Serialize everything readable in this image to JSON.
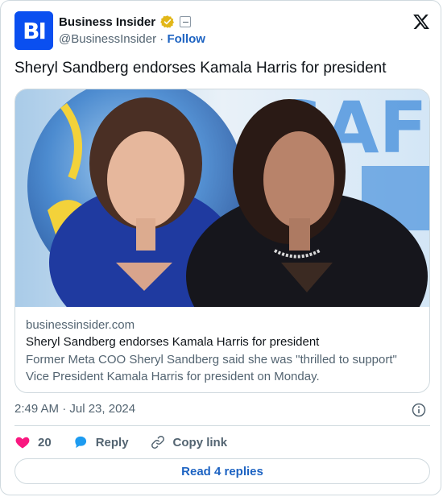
{
  "account": {
    "avatar_text": "BI",
    "display_name": "Business Insider",
    "handle": "@BusinessInsider",
    "separator": " · ",
    "follow_label": "Follow"
  },
  "tweet": {
    "text": "Sheryl Sandberg endorses Kamala Harris for president",
    "timestamp": "2:49 AM · Jul 23, 2024"
  },
  "link_card": {
    "domain": "businessinsider.com",
    "title": "Sheryl Sandberg endorses Kamala Harris for president",
    "description": "Former Meta COO Sheryl Sandberg said she was \"thrilled to support\" Vice President Kamala Harris for president on Monday.",
    "image_text": "SAFE"
  },
  "actions": {
    "like_count": "20",
    "reply_label": "Reply",
    "copy_link_label": "Copy link"
  },
  "replies_button": {
    "label": "Read 4 replies"
  },
  "colors": {
    "accent": "#1d63c2",
    "brand": "#0a4ff0",
    "like": "#f91880",
    "muted": "#536471",
    "border": "#cfd9de"
  },
  "icons": [
    "verified-badge-icon",
    "affiliate-badge-icon",
    "x-logo-icon",
    "info-icon",
    "heart-icon",
    "reply-bubble-icon",
    "link-icon"
  ]
}
